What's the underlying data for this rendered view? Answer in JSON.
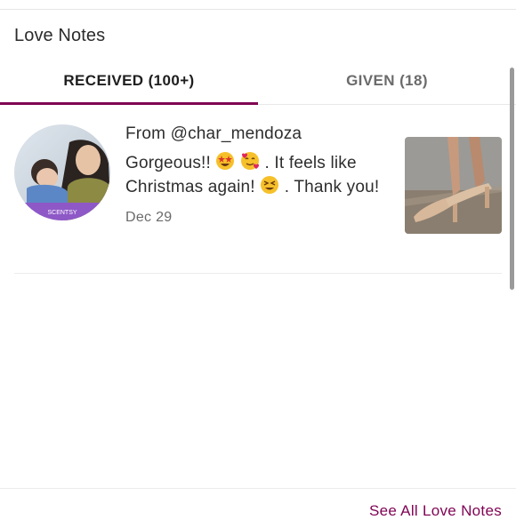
{
  "section": {
    "title": "Love Notes"
  },
  "tabs": [
    {
      "label": "RECEIVED (100+)",
      "active": true
    },
    {
      "label": "GIVEN (18)",
      "active": false
    }
  ],
  "note": {
    "from": "From @char_mendoza",
    "text_part1": "Gorgeous!! ",
    "text_part2": ". It feels like Christmas again! ",
    "text_part3": ". Thank you!",
    "date": "Dec 29",
    "emojis": [
      "star-struck-emoji",
      "smiling-face-with-hearts-emoji",
      "tired-face-emoji"
    ],
    "avatar_badge_text": "SCENTSY"
  },
  "footer": {
    "see_all_label": "See All Love Notes"
  },
  "colors": {
    "accent": "#7f0353",
    "divider": "#ececec"
  }
}
